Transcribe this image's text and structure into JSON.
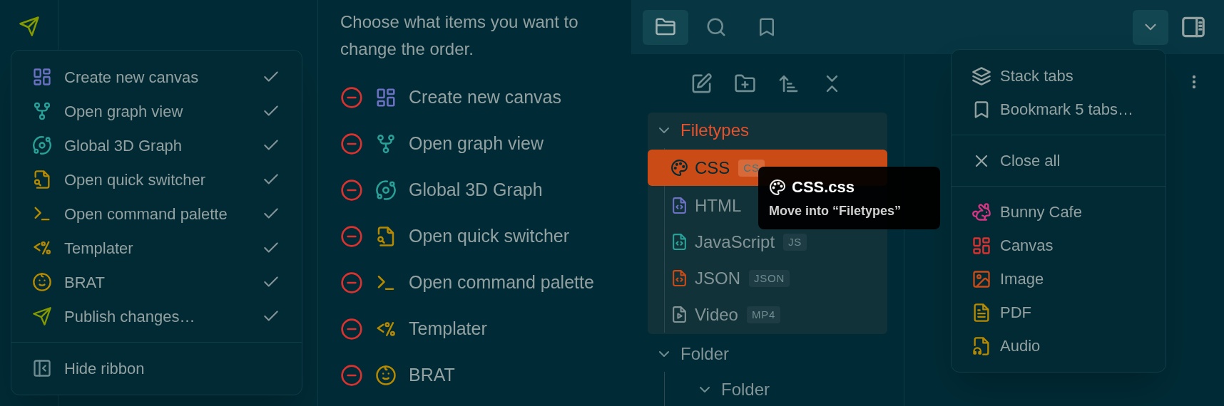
{
  "ribbon_menu": {
    "items": [
      {
        "label": "Create new canvas",
        "color": "#6c71c4",
        "checked": true
      },
      {
        "label": "Open graph view",
        "color": "#2aa198",
        "checked": true
      },
      {
        "label": "Global 3D Graph",
        "color": "#2aa198",
        "checked": true
      },
      {
        "label": "Open quick switcher",
        "color": "#b58900",
        "checked": true
      },
      {
        "label": "Open command palette",
        "color": "#b58900",
        "checked": true
      },
      {
        "label": "Templater",
        "color": "#b58900",
        "checked": true
      },
      {
        "label": "BRAT",
        "color": "#b58900",
        "checked": true
      },
      {
        "label": "Publish changes…",
        "color": "#859900",
        "checked": true
      }
    ],
    "footer": "Hide ribbon"
  },
  "settings": {
    "description": "Choose what items you want to change the order.",
    "items": [
      {
        "label": "Create new canvas",
        "color": "#6c71c4"
      },
      {
        "label": "Open graph view",
        "color": "#2aa198"
      },
      {
        "label": "Global 3D Graph",
        "color": "#2aa198"
      },
      {
        "label": "Open quick switcher",
        "color": "#b58900"
      },
      {
        "label": "Open command palette",
        "color": "#b58900"
      },
      {
        "label": "Templater",
        "color": "#b58900"
      },
      {
        "label": "BRAT",
        "color": "#b58900"
      }
    ]
  },
  "explorer": {
    "tabs": [
      {
        "selected": true
      },
      {
        "selected": false
      },
      {
        "selected": false
      }
    ],
    "tree": [
      {
        "title": "Filetypes",
        "expanded": true,
        "drop_target": true,
        "children": [
          {
            "label": "CSS",
            "badge": "CS",
            "color": "#002b36",
            "selected": true
          },
          {
            "label": "HTML",
            "color": "#6c71c4",
            "selected": false
          },
          {
            "label": "JavaScript",
            "badge": "JS",
            "color": "#2aa198",
            "selected": false
          },
          {
            "label": "JSON",
            "badge": "JSON",
            "color": "#cb4b16",
            "selected": false
          },
          {
            "label": "Video",
            "badge": "MP4",
            "color": "#839496",
            "selected": false
          }
        ]
      },
      {
        "title": "Folder",
        "expanded": true,
        "drop_target": false,
        "children": [
          {
            "title": "Folder",
            "expanded": true,
            "drop_target": false
          }
        ]
      }
    ]
  },
  "tooltip": {
    "title": "CSS.css",
    "text": "Move into “Filetypes”"
  },
  "tab_menu": {
    "sections": [
      [
        {
          "label": "Stack tabs",
          "color": "#93a1a1"
        },
        {
          "label": "Bookmark 5 tabs…",
          "color": "#93a1a1"
        }
      ],
      [
        {
          "label": "Close all",
          "color": "#93a1a1"
        }
      ],
      [
        {
          "label": "Bunny Cafe",
          "color": "#d33682"
        },
        {
          "label": "Canvas",
          "color": "#dc322f"
        },
        {
          "label": "Image",
          "color": "#cb4b16"
        },
        {
          "label": "PDF",
          "color": "#b58900"
        },
        {
          "label": "Audio",
          "color": "#b58900"
        }
      ]
    ]
  }
}
